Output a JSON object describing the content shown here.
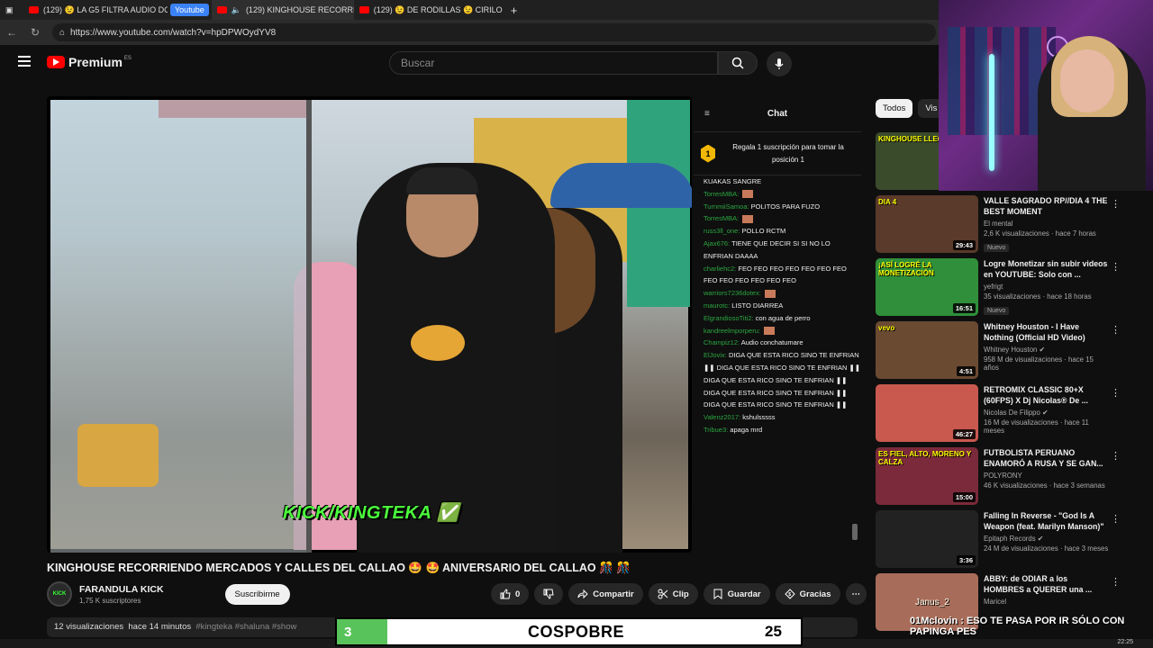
{
  "browser": {
    "tabs": [
      {
        "label": "(129) 😉 LA G5 FILTRA AUDIO DC"
      },
      {
        "label": "(129) KINGHOUSE RECORRI"
      },
      {
        "label": "(129) 😉 DE RODILLAS 😉 CIRILO"
      }
    ],
    "pill_label": "Youtube",
    "url": "https://www.youtube.com/watch?v=hpDPWOydYV8"
  },
  "header": {
    "logo_text": "Premium",
    "logo_region": "ES",
    "search_placeholder": "Buscar"
  },
  "video": {
    "overlay_tag": "KICK/KINGTEKA ✅",
    "title": "KINGHOUSE RECORRIENDO MERCADOS Y CALLES DEL CALLAO 🤩 🤩 ANIVERSARIO DEL CALLAO 🎊 🎊",
    "channel_name": "FARANDULA KICK",
    "subscribers": "1,75 K suscriptores",
    "subscribe_label": "Suscribirme",
    "likes": "0",
    "share_label": "Compartir",
    "clip_label": "Clip",
    "save_label": "Guardar",
    "thanks_label": "Gracias",
    "views": "12 visualizaciones",
    "age": "hace 14 minutos",
    "tags": "#kingteka #shaluna #show",
    "avatar_text": "KICK"
  },
  "chat": {
    "title": "Chat",
    "pinned_rank": "1",
    "pinned_text": "Regala 1 suscripción para tomar la posición 1",
    "messages": [
      {
        "user": "",
        "text": "KUAKAS SANGRE"
      },
      {
        "user": "TorresMBA:",
        "text": ""
      },
      {
        "user": "TurnmiiSamoa:",
        "text": "POLITOS PARA FUZO"
      },
      {
        "user": "TorresMBA:",
        "text": ""
      },
      {
        "user": "russ3ll_one:",
        "text": "POLLO RCTM"
      },
      {
        "user": "Ajax676:",
        "text": "TIENE QUE DECIR SI SI NO LO ENFRIAN DAAAA"
      },
      {
        "user": "charliehc2:",
        "text": "FEO FEO FEO FEO FEO FEO FEO FEO FEO FEO FEO FEO FEO"
      },
      {
        "user": "warriors7236dotex:",
        "text": ""
      },
      {
        "user": "maurotc:",
        "text": "LISTO DIARREA"
      },
      {
        "user": "ElgrandiosoTiti2:",
        "text": "con agua de perro"
      },
      {
        "user": "kandreelmporperu:",
        "text": ""
      },
      {
        "user": "Champiz12:",
        "text": "Audio conchatumare"
      },
      {
        "user": "ElJovix:",
        "text": "DIGA QUE ESTA RICO SINO TE ENFRIAN ❚❚ DIGA QUE ESTA RICO SINO TE ENFRIAN ❚❚ DIGA QUE ESTA RICO SINO TE ENFRIAN ❚❚ DIGA QUE ESTA RICO SINO TE ENFRIAN ❚❚ DIGA QUE ESTA RICO SINO TE ENFRIAN ❚❚"
      },
      {
        "user": "Valenz2017:",
        "text": "kshulsssss"
      },
      {
        "user": "Tribue3:",
        "text": "apaga mrd"
      }
    ]
  },
  "sidebar": {
    "chips": [
      "Todos",
      "Vis"
    ],
    "recommendations": [
      {
        "title": "",
        "channel": "",
        "meta": "",
        "duration": "",
        "badge": "",
        "thumb_color": "#3a4b2c",
        "thumb_text": "KINGHOUSE LLEGA"
      },
      {
        "title": "VALLE SAGRADO RP//DIA 4 THE BEST MOMENT",
        "channel": "El mental",
        "meta": "2,6 K visualizaciones · hace 7 horas",
        "duration": "29:43",
        "badge": "Nuevo",
        "thumb_color": "#5a3a2a",
        "thumb_text": "DIA 4"
      },
      {
        "title": "Logre Monetizar sin subir videos en YOUTUBE: Solo con ...",
        "channel": "yefrigt",
        "meta": "35 visualizaciones · hace 18 horas",
        "duration": "16:51",
        "badge": "Nuevo",
        "thumb_color": "#2f8f3a",
        "thumb_text": "¡ASÍ LOGRÉ LA MONETIZACIÓN"
      },
      {
        "title": "Whitney Houston - I Have Nothing (Official HD Video)",
        "channel": "Whitney Houston ✔",
        "meta": "958 M de visualizaciones · hace 15 años",
        "duration": "4:51",
        "badge": "",
        "thumb_color": "#6b4a32",
        "thumb_text": "vevo"
      },
      {
        "title": "RETROMIX CLASSIC 80+X (60FPS) X Dj Nicolas® De ...",
        "channel": "Nicolas De Filippo ✔",
        "meta": "16 M de visualizaciones · hace 11 meses",
        "duration": "46:27",
        "badge": "",
        "thumb_color": "#c9584f",
        "thumb_text": ""
      },
      {
        "title": "FUTBOLISTA PERUANO ENAMORÓ A RUSA Y SE GAN...",
        "channel": "POLYRONY",
        "meta": "46 K visualizaciones · hace 3 semanas",
        "duration": "15:00",
        "badge": "",
        "thumb_color": "#7a2a3a",
        "thumb_text": "ES FIEL, ALTO, MORENO Y CALZA"
      },
      {
        "title": "Falling In Reverse - \"God Is A Weapon (feat. Marilyn Manson)\"",
        "channel": "Epitaph Records ✔",
        "meta": "24 M de visualizaciones · hace 3 meses",
        "duration": "3:36",
        "badge": "",
        "thumb_color": "#222222",
        "thumb_text": ""
      },
      {
        "title": "ABBY: de ODIAR a los HOMBRES a QUERER una ...",
        "channel": "Maricel",
        "meta": "",
        "duration": "",
        "badge": "",
        "thumb_color": "#a86d5a",
        "thumb_text": ""
      }
    ]
  },
  "scoreboard": {
    "left": "3",
    "name": "COSPOBRE",
    "right": "25"
  },
  "stream_overlay": {
    "name_tag": "Janus_2",
    "ticker": "01Mclovin : ESO TE PASA POR IR SÓLO CON",
    "ticker2": "PAPINGA PES"
  },
  "taskbar": {
    "clock": "22:25"
  },
  "colors": {
    "accent_red": "#ff0000",
    "chat_user": "#2ba640",
    "score_green": "#59c35b"
  }
}
